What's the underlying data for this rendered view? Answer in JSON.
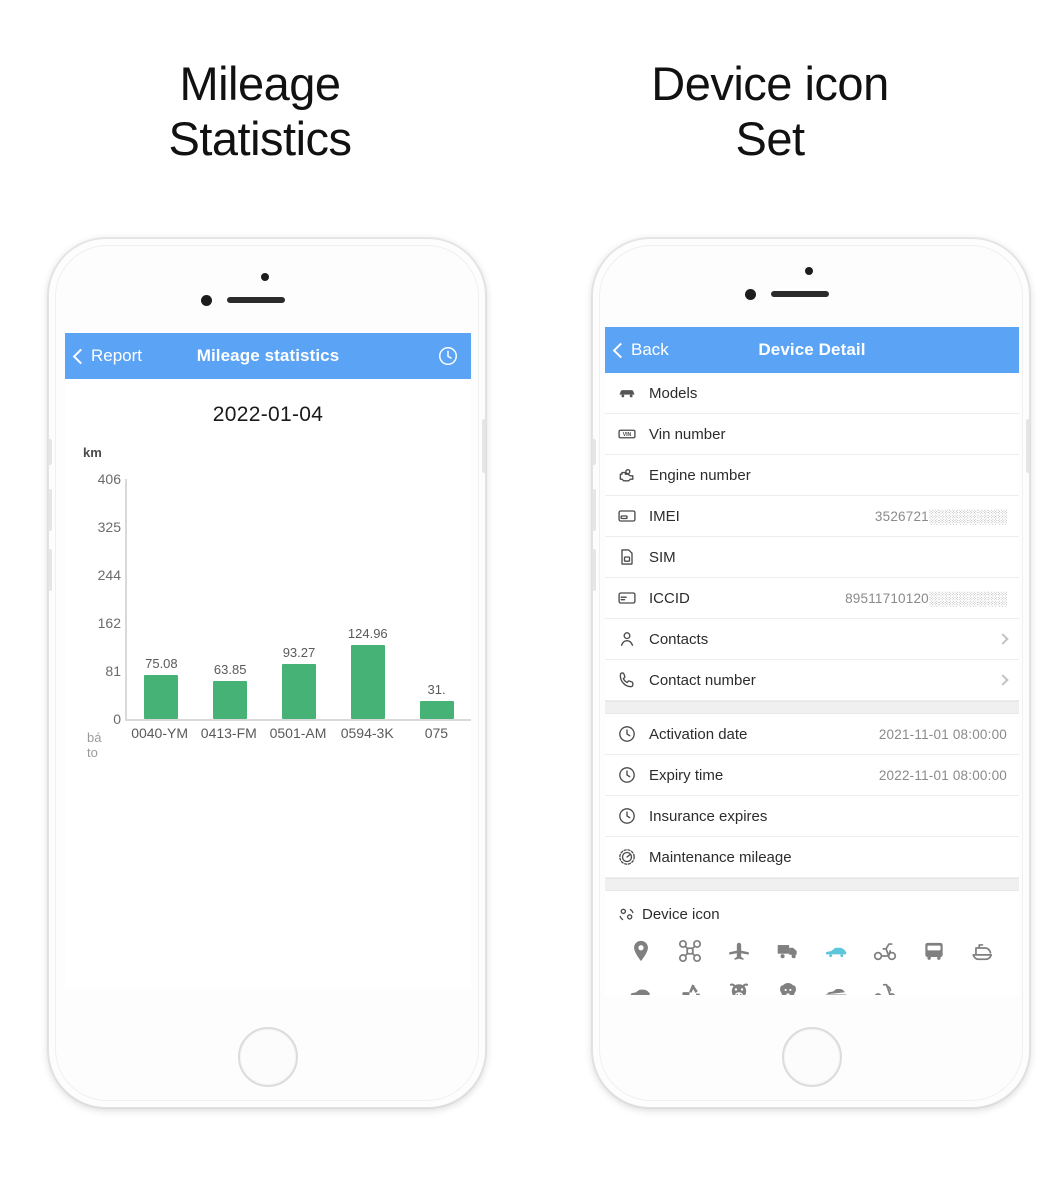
{
  "captions": {
    "left": "Mileage\nStatistics",
    "right": "Device icon\nSet"
  },
  "left_phone": {
    "navbar": {
      "back_label": "Report",
      "title": "Mileage statistics",
      "right_icon": "clock-icon"
    },
    "date": "2022-01-04",
    "axis_footer": "bá\nto"
  },
  "right_phone": {
    "navbar": {
      "back_label": "Back",
      "title": "Device Detail"
    },
    "rows": [
      {
        "icon": "car-icon",
        "label": "Models",
        "value": "",
        "chevron": false
      },
      {
        "icon": "vin-badge-icon",
        "label": "Vin number",
        "value": "",
        "chevron": false
      },
      {
        "icon": "engine-icon",
        "label": "Engine number",
        "value": "",
        "chevron": false
      },
      {
        "icon": "card-icon",
        "label": "IMEI",
        "value": "3526721░░░░░░░░",
        "chevron": false
      },
      {
        "icon": "sim-icon",
        "label": "SIM",
        "value": "",
        "chevron": false
      },
      {
        "icon": "card-lines-icon",
        "label": "ICCID",
        "value": "89511710120░░░░░░░░",
        "chevron": false
      },
      {
        "icon": "person-icon",
        "label": "Contacts",
        "value": "",
        "chevron": true
      },
      {
        "icon": "phone-icon",
        "label": "Contact number",
        "value": "",
        "chevron": true
      }
    ],
    "rows2": [
      {
        "icon": "clock-icon",
        "label": "Activation date",
        "value": "2021-11-01 08:00:00"
      },
      {
        "icon": "clock-icon",
        "label": "Expiry time",
        "value": "2022-11-01 08:00:00"
      },
      {
        "icon": "clock-icon",
        "label": "Insurance expires",
        "value": ""
      },
      {
        "icon": "gauge-icon",
        "label": "Maintenance mileage",
        "value": ""
      }
    ],
    "icon_section": {
      "header_icon": "settings-icon",
      "header_label": "Device icon",
      "selected_index": 4,
      "icons": [
        "location-pin-icon",
        "drone-icon",
        "airplane-icon",
        "truck-icon",
        "car-sport-icon",
        "moped-icon",
        "bus-icon",
        "boat-icon",
        "car-side-icon",
        "excavator-icon",
        "cow-icon",
        "dog-icon",
        "pickup-icon",
        "kick-scooter-icon"
      ]
    }
  },
  "colors": {
    "nav_blue": "#5ba3f5",
    "bar_green": "#46b276",
    "selected_icon": "#5cc6da",
    "icon_gray": "#808080"
  },
  "chart_data": {
    "type": "bar",
    "title": "2022-01-04",
    "xlabel": "",
    "ylabel": "km",
    "categories": [
      "0040-YM",
      "0413-FM",
      "0501-AM",
      "0594-3K",
      "075"
    ],
    "values": [
      75.08,
      63.85,
      93.27,
      124.96,
      31.2
    ],
    "value_labels": [
      "75.08",
      "63.85",
      "93.27",
      "124.96",
      "31."
    ],
    "yticks": [
      0,
      81,
      162,
      244,
      325,
      406
    ],
    "ylim": [
      0,
      406
    ],
    "grid": false,
    "legend": "none",
    "series_color": "#46b276",
    "note": "last bar and its label are clipped by the screen edge"
  }
}
